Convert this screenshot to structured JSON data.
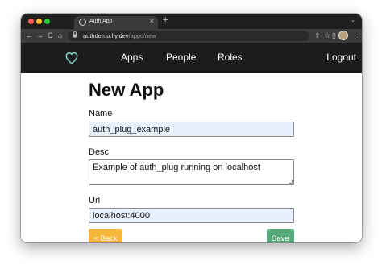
{
  "browser": {
    "tab_title": "Auth App",
    "tab_close": "×",
    "new_tab": "+",
    "tab_menu": "⌄",
    "nav_back": "←",
    "nav_forward": "→",
    "reload": "C",
    "home": "⌂",
    "url_host": "authdemo.fly.dev",
    "url_path": "/apps/new",
    "share": "⇪",
    "bookmark": "☆",
    "sidepanel": "▯",
    "menu": "⋮"
  },
  "nav": {
    "items": [
      {
        "label": "Apps"
      },
      {
        "label": "People"
      },
      {
        "label": "Roles"
      }
    ],
    "logout": "Logout"
  },
  "form": {
    "title": "New App",
    "name_label": "Name",
    "name_value": "auth_plug_example",
    "desc_label": "Desc",
    "desc_value": "Example of auth_plug running on localhost",
    "url_label": "Url",
    "url_value": "localhost:4000",
    "back_button": "< Back",
    "save_button": "Save"
  },
  "colors": {
    "nav_bg": "#1c1c1c",
    "heart": "#7fd6c8",
    "back_button": "#f5b63a",
    "save_button": "#55a877",
    "input_autofill": "#e8f0fe"
  }
}
